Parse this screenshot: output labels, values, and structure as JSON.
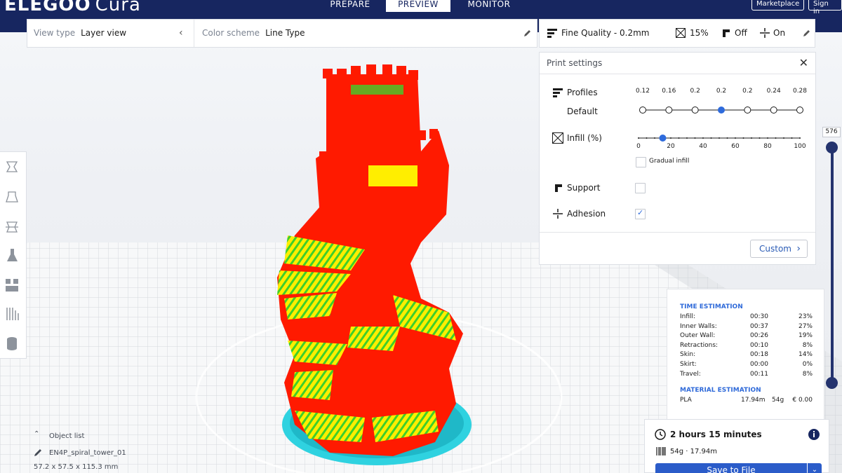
{
  "app": {
    "brand": "ELEGOO",
    "product": "Cura"
  },
  "stages": [
    {
      "label": "PREPARE",
      "active": false
    },
    {
      "label": "PREVIEW",
      "active": true
    },
    {
      "label": "MONITOR",
      "active": false
    }
  ],
  "header_buttons": {
    "marketplace": "Marketplace",
    "signin": "Sign in"
  },
  "view": {
    "view_type_label": "View type",
    "view_type_value": "Layer view",
    "color_scheme_label": "Color scheme",
    "color_scheme_value": "Line Type"
  },
  "settings_bar": {
    "quality": "Fine Quality - 0.2mm",
    "infill": "15%",
    "support": "Off",
    "adhesion": "On"
  },
  "print_settings": {
    "title": "Print settings",
    "profiles_label": "Profiles",
    "profile_default": "Default",
    "profile_ticks": [
      "0.12",
      "0.16",
      "0.2",
      "0.2",
      "0.2",
      "0.24",
      "0.28"
    ],
    "profile_selected_index": 3,
    "infill_label": "Infill (%)",
    "infill_ticks": [
      "0",
      "20",
      "40",
      "60",
      "80",
      "100"
    ],
    "infill_value": 15,
    "gradual_infill": "Gradual infill",
    "support_label": "Support",
    "adhesion_label": "Adhesion",
    "support_checked": false,
    "adhesion_checked": true,
    "custom_button": "Custom"
  },
  "layer": {
    "current": "576"
  },
  "estimation": {
    "time_heading": "TIME ESTIMATION",
    "rows": [
      {
        "name": "Infill:",
        "time": "00:30",
        "pct": "23%"
      },
      {
        "name": "Inner Walls:",
        "time": "00:37",
        "pct": "27%"
      },
      {
        "name": "Outer Wall:",
        "time": "00:26",
        "pct": "19%"
      },
      {
        "name": "Retractions:",
        "time": "00:10",
        "pct": "8%"
      },
      {
        "name": "Skin:",
        "time": "00:18",
        "pct": "14%"
      },
      {
        "name": "Skirt:",
        "time": "00:00",
        "pct": "0%"
      },
      {
        "name": "Travel:",
        "time": "00:11",
        "pct": "8%"
      }
    ],
    "material_heading": "MATERIAL ESTIMATION",
    "material": {
      "name": "PLA",
      "length": "17.94m",
      "weight": "54g",
      "cost": "€ 0.00"
    }
  },
  "summary": {
    "time": "2 hours 15 minutes",
    "material": "54g · 17.94m",
    "save_button": "Save to File"
  },
  "object": {
    "list_label": "Object list",
    "name": "EN4P_spiral_tower_01",
    "dimensions": "57.2 x 57.5 x 115.3 mm"
  },
  "colors": {
    "header_bg": "#172660",
    "accent_blue": "#2b5cc9",
    "model_red": "#ff1a00",
    "model_yellow": "#ffee00",
    "model_green": "#3ecf2a",
    "skirt_cyan": "#2fd2e0"
  }
}
